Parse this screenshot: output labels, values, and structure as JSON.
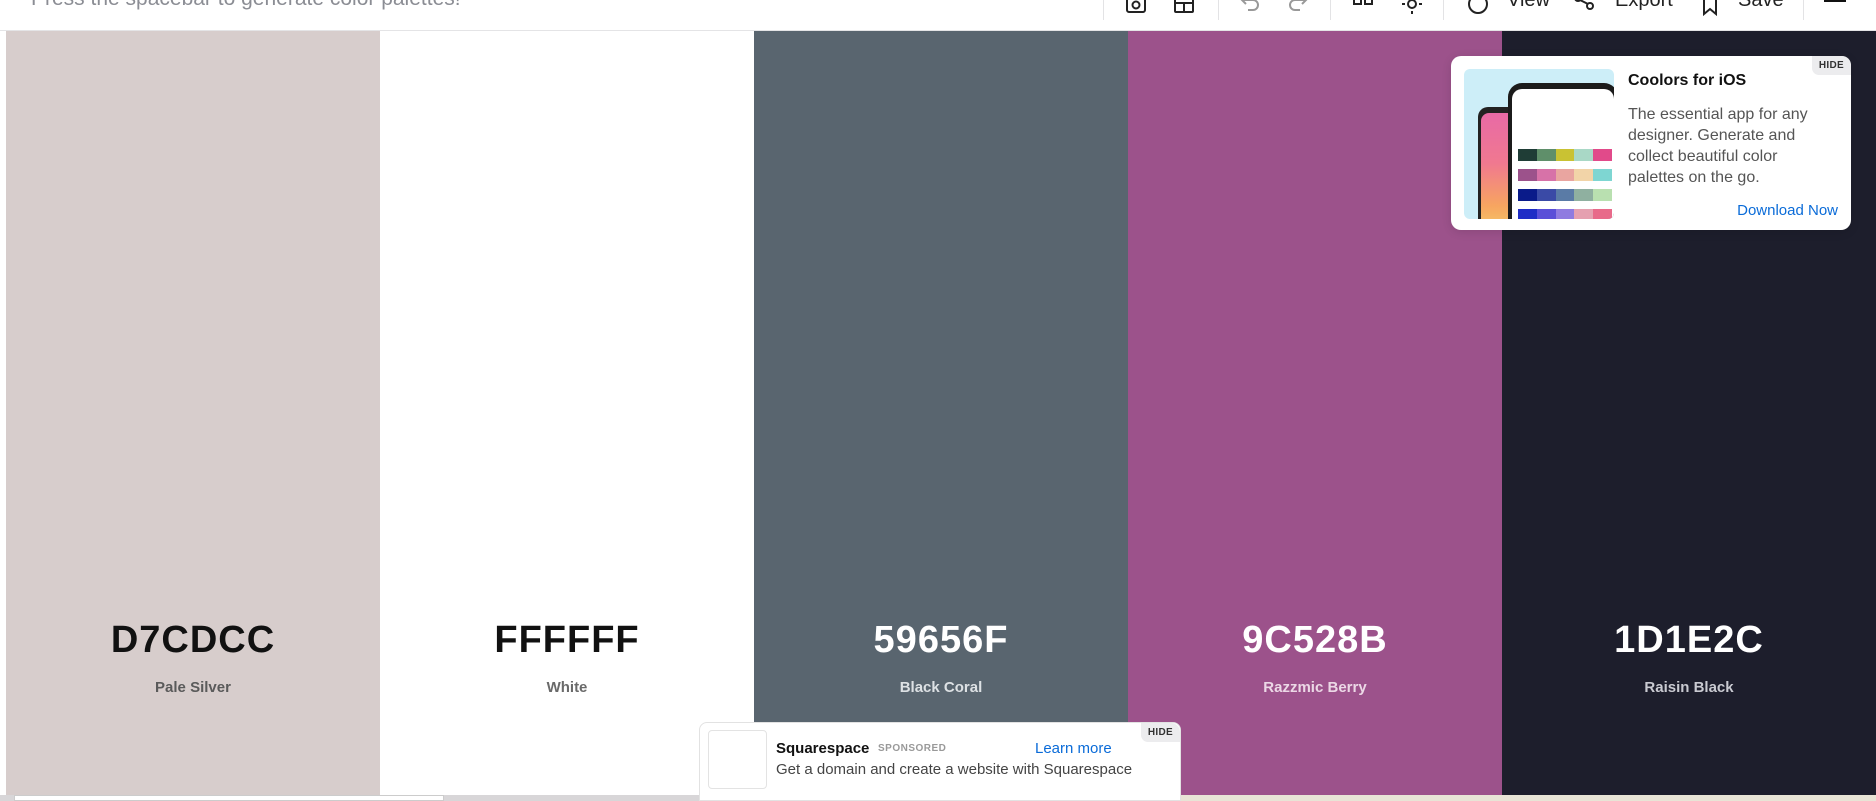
{
  "toolbar": {
    "hint": "Press the spacebar to generate color palettes!",
    "view_label": "View",
    "export_label": "Export",
    "save_label": "Save",
    "icons": [
      "camera-icon",
      "layout-icon",
      "undo-icon",
      "redo-icon",
      "grid-icon",
      "sun-icon",
      "eye-icon",
      "share-icon",
      "star-icon",
      "menu-icon"
    ]
  },
  "palette": {
    "swatches": [
      {
        "hex": "D7CDCC",
        "name": "Pale Silver",
        "bg": "#D7CDCC",
        "hex_color": "#111111",
        "name_color": "#5a5a5a"
      },
      {
        "hex": "FFFFFF",
        "name": "White",
        "bg": "#FFFFFF",
        "hex_color": "#111111",
        "name_color": "#6a6a6a"
      },
      {
        "hex": "59656F",
        "name": "Black Coral",
        "bg": "#59656F",
        "hex_color": "#ffffff",
        "name_color": "#dde1e4"
      },
      {
        "hex": "9C528B",
        "name": "Razzmic Berry",
        "bg": "#9C528B",
        "hex_color": "#ffffff",
        "name_color": "#ecd8e6"
      },
      {
        "hex": "1D1E2C",
        "name": "Raisin Black",
        "bg": "#1D1E2C",
        "hex_color": "#ffffff",
        "name_color": "#c9cad1"
      }
    ]
  },
  "promo": {
    "title": "Coolors for iOS",
    "description": "The essential app for any designer. Generate and collect beautiful color palettes on the go.",
    "link": "Download Now",
    "hide": "HIDE"
  },
  "ad": {
    "title": "Squarespace",
    "badge": "SPONSORED",
    "learn_more": "Learn more",
    "description": "Get a domain and create a website with Squarespace",
    "hide": "HIDE"
  }
}
